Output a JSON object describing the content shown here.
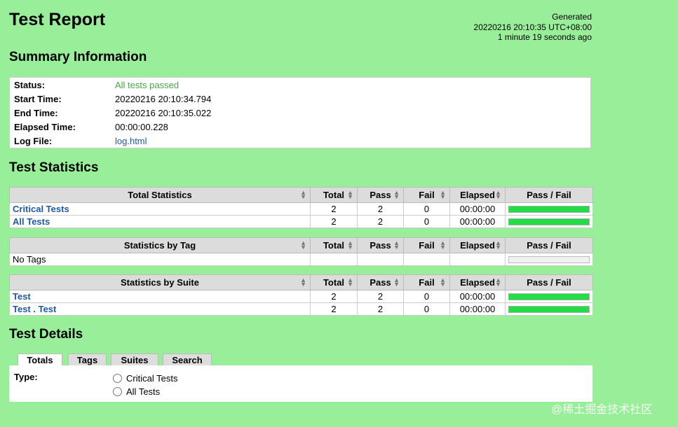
{
  "header": {
    "title": "Test Report",
    "generated_label": "Generated",
    "generated_time": "20220216 20:10:35 UTC+08:00",
    "generated_ago": "1 minute 19 seconds ago"
  },
  "summary": {
    "heading": "Summary Information",
    "rows": [
      {
        "label": "Status:",
        "value": "All tests passed"
      },
      {
        "label": "Start Time:",
        "value": "20220216 20:10:34.794"
      },
      {
        "label": "End Time:",
        "value": "20220216 20:10:35.022"
      },
      {
        "label": "Elapsed Time:",
        "value": "00:00:00.228"
      },
      {
        "label": "Log File:",
        "value": "log.html"
      }
    ]
  },
  "statistics": {
    "heading": "Test Statistics",
    "columns": [
      "Total",
      "Pass",
      "Fail",
      "Elapsed",
      "Pass / Fail"
    ],
    "total": {
      "header": "Total Statistics",
      "rows": [
        {
          "name": "Critical Tests",
          "total": "2",
          "pass": "2",
          "fail": "0",
          "elapsed": "00:00:00",
          "pass_ratio": 1.0
        },
        {
          "name": "All Tests",
          "total": "2",
          "pass": "2",
          "fail": "0",
          "elapsed": "00:00:00",
          "pass_ratio": 1.0
        }
      ]
    },
    "tag": {
      "header": "Statistics by Tag",
      "rows": [
        {
          "name": "No Tags",
          "total": "",
          "pass": "",
          "fail": "",
          "elapsed": "",
          "pass_ratio": 0
        }
      ]
    },
    "suite": {
      "header": "Statistics by Suite",
      "rows": [
        {
          "name": "Test",
          "total": "2",
          "pass": "2",
          "fail": "0",
          "elapsed": "00:00:00",
          "pass_ratio": 1.0
        },
        {
          "name": "Test . Test",
          "total": "2",
          "pass": "2",
          "fail": "0",
          "elapsed": "00:00:00",
          "pass_ratio": 1.0
        }
      ]
    }
  },
  "details": {
    "heading": "Test Details",
    "tabs": [
      "Totals",
      "Tags",
      "Suites",
      "Search"
    ],
    "active_tab": "Totals",
    "type_label": "Type:",
    "options": [
      "Critical Tests",
      "All Tests"
    ]
  },
  "watermark": "@稀土掘金技术社区",
  "colors": {
    "background": "#99ee99",
    "pass_text": "#44aa44",
    "link": "#1d5aa6",
    "bar_pass": "#22dd44"
  }
}
